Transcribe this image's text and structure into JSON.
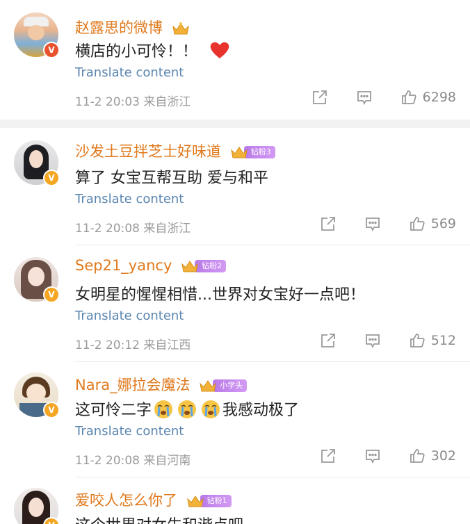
{
  "comments": [
    {
      "username": "赵露思的微博",
      "level_tag": "",
      "text": "横店的小可怜！！",
      "translate": "Translate content",
      "time": "11-2 20:03",
      "location": "来自浙江",
      "likes": "6298"
    },
    {
      "username": "沙发土豆拌芝士好味道",
      "level_tag": "钻粉3",
      "text": "算了 女宝互帮互助 爱与和平",
      "translate": "Translate content",
      "time": "11-2 20:08",
      "location": "来自浙江",
      "likes": "569"
    },
    {
      "username": "Sep21_yancy",
      "level_tag": "钻粉2",
      "text": "女明星的惺惺相惜...世界对女宝好一点吧！",
      "translate": "Translate content",
      "time": "11-2 20:12",
      "location": "来自江西",
      "likes": "512"
    },
    {
      "username": "Nara_娜拉会魔法",
      "level_tag": "小学头",
      "text_before": "这可怜二字",
      "text_after": "我感动极了",
      "translate": "Translate content",
      "time": "11-2 20:08",
      "location": "来自河南",
      "likes": "302"
    },
    {
      "username": "爱咬人怎么你了",
      "level_tag": "钻粉1",
      "text": "这个世界对女生和谐点吧"
    }
  ],
  "icons": {
    "share": "share-icon",
    "comment": "comment-icon",
    "like": "thumbs-up-icon",
    "heart": "heart-emoji",
    "crying": "crying-face-emoji",
    "crown": "crown-icon",
    "verified": "verified-badge-icon"
  },
  "colors": {
    "username": "#e07a1e",
    "translate": "#5a86b0",
    "meta": "#9a9a9a",
    "heart": "#e8322e",
    "tag": "#c08af0"
  }
}
